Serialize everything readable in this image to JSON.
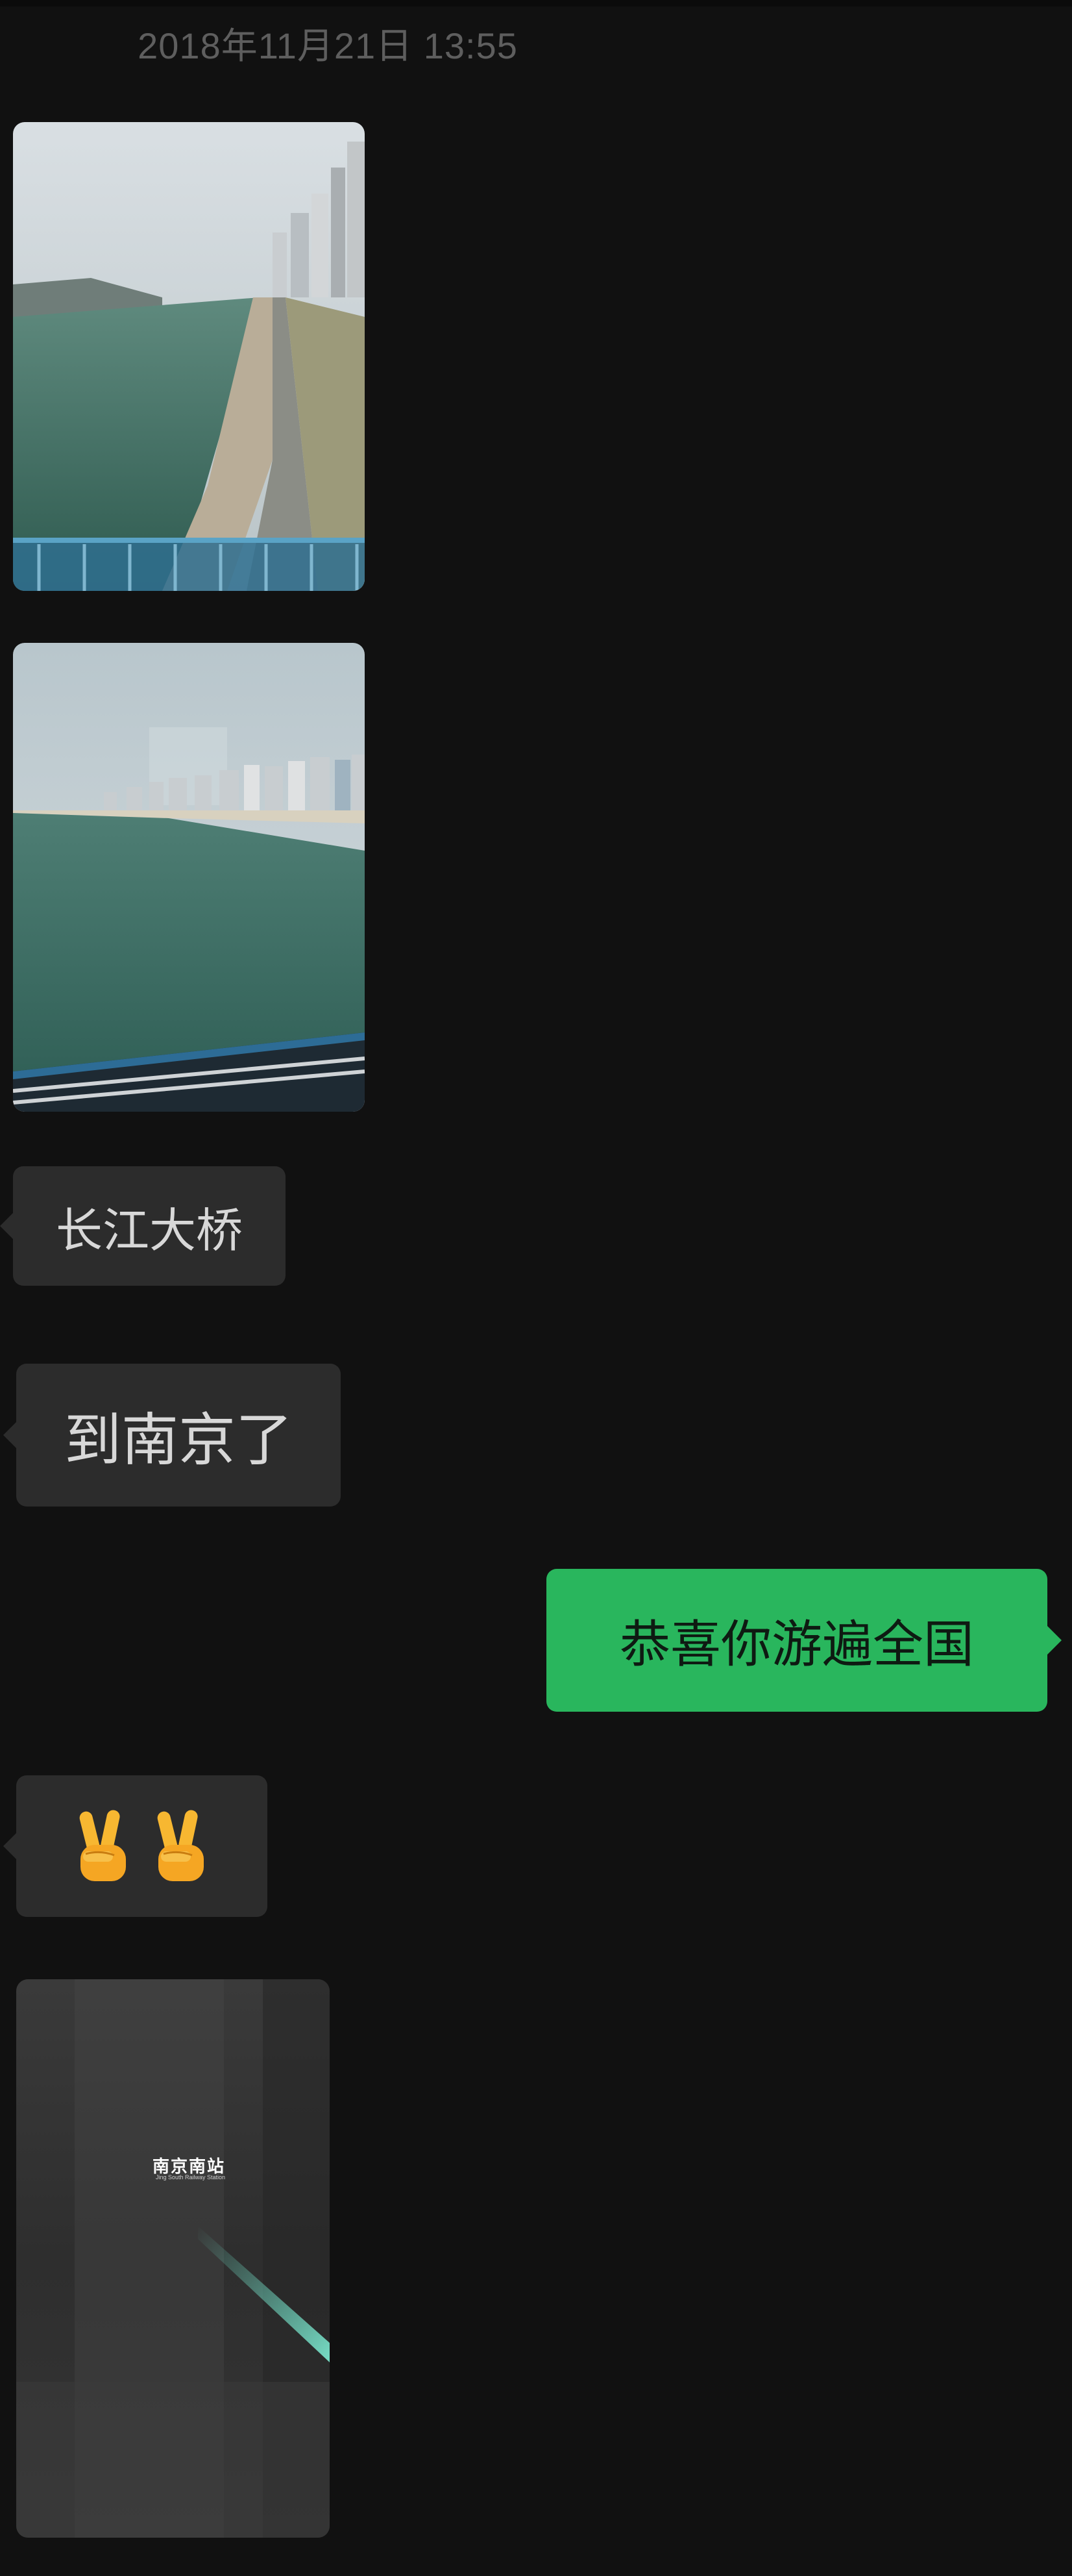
{
  "timestamp": "2018年11月21日 13:55",
  "messages": [
    {
      "kind": "image",
      "side": "left",
      "icon": "river-bridge-photo"
    },
    {
      "kind": "image",
      "side": "left",
      "icon": "river-skyline-photo"
    },
    {
      "kind": "text",
      "side": "left",
      "text": "长江大桥"
    },
    {
      "kind": "text",
      "side": "left",
      "text": "到南京了"
    },
    {
      "kind": "text",
      "side": "right",
      "text": "恭喜你游遍全国"
    },
    {
      "kind": "emoji",
      "side": "left",
      "icons": [
        "victory-hand-emoji",
        "victory-hand-emoji"
      ]
    },
    {
      "kind": "image",
      "side": "left",
      "icon": "station-night-photo",
      "caption_title": "南京南站",
      "caption_sub": "Jing South Railway Station"
    }
  ],
  "colors": {
    "background": "#111111",
    "incoming_bubble": "#2c2c2c",
    "outgoing_bubble": "#29b65d",
    "timestamp_text": "#5e5e5e"
  }
}
